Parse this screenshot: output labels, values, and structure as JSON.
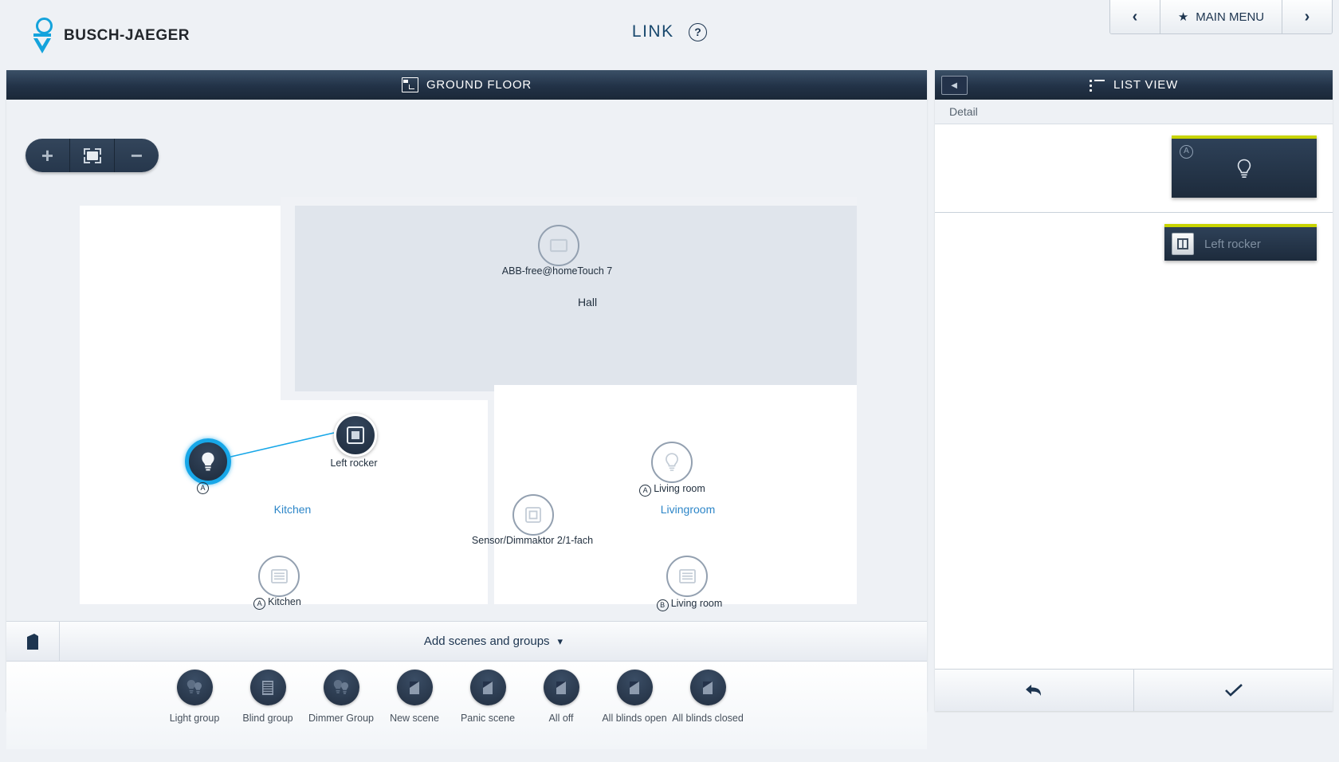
{
  "brand": {
    "name": "BUSCH-JAEGER",
    "logo_color": "#14a3dc"
  },
  "header": {
    "title": "LINK",
    "help_icon": "question-mark-circle-icon",
    "main_menu": {
      "prev_icon": "chevron-left-icon",
      "next_icon": "chevron-right-icon",
      "star_icon": "star-icon",
      "label": "MAIN MENU"
    }
  },
  "floorplan": {
    "header_title": "GROUND FLOOR",
    "header_icon": "floorplan-icon",
    "zoom_controls": {
      "zoom_in": "+",
      "fit": "fit-to-screen-icon",
      "zoom_out": "−"
    },
    "rooms": [
      {
        "name": "Hall",
        "color": "#22303f"
      },
      {
        "name": "Kitchen",
        "color": "#2d86c8"
      },
      {
        "name": "Livingroom",
        "color": "#2d86c8"
      }
    ],
    "devices": [
      {
        "id": "touch7",
        "label": "ABB-free@homeTouch 7",
        "icon": "panel-display-icon",
        "state": "inactive"
      },
      {
        "id": "bulb-a-kitchen",
        "label": "A",
        "icon": "lightbulb-icon",
        "state": "selected"
      },
      {
        "id": "left-rocker",
        "label": "Left rocker",
        "icon": "rocker-switch-icon",
        "state": "active"
      },
      {
        "id": "bulb-living",
        "badge": "A",
        "label": "Living room",
        "icon": "lightbulb-icon",
        "state": "inactive"
      },
      {
        "id": "dimmer",
        "label": "Sensor/Dimmaktor 2/1-fach",
        "icon": "dimmer-actuator-icon",
        "state": "inactive"
      },
      {
        "id": "blind-kitchen",
        "badge": "A",
        "label": "Kitchen",
        "icon": "blind-actuator-icon",
        "state": "inactive"
      },
      {
        "id": "blind-living",
        "badge": "B",
        "label": "Living room",
        "icon": "blind-actuator-icon",
        "state": "inactive"
      }
    ],
    "link_color": "#17a7e8"
  },
  "scenes_bar": {
    "home_icon": "house-icon",
    "label": "Add scenes and groups",
    "caret_icon": "chevron-down-icon"
  },
  "tray": [
    {
      "label": "Light group",
      "icon": "light-group-icon"
    },
    {
      "label": "Blind group",
      "icon": "blind-group-icon"
    },
    {
      "label": "Dimmer Group",
      "icon": "dimmer-group-icon"
    },
    {
      "label": "New scene",
      "icon": "scene-icon"
    },
    {
      "label": "Panic scene",
      "icon": "scene-icon"
    },
    {
      "label": "All off",
      "icon": "scene-icon"
    },
    {
      "label": "All blinds open",
      "icon": "scene-icon"
    },
    {
      "label": "All blinds closed",
      "icon": "scene-icon"
    }
  ],
  "list_view": {
    "header_title": "LIST VIEW",
    "header_icon": "list-icon",
    "collapse_icon": "collapse-left-icon",
    "detail_label": "Detail",
    "cards": [
      {
        "id": "light-card",
        "badge": "A",
        "icon": "lightbulb-icon",
        "label": "",
        "accent": "#c8d400"
      },
      {
        "id": "rocker-card",
        "icon": "rocker-switch-icon",
        "label": "Left rocker",
        "accent": "#c8d400"
      }
    ],
    "footer": {
      "back_icon": "undo-arrow-icon",
      "confirm_icon": "checkmark-icon"
    }
  }
}
